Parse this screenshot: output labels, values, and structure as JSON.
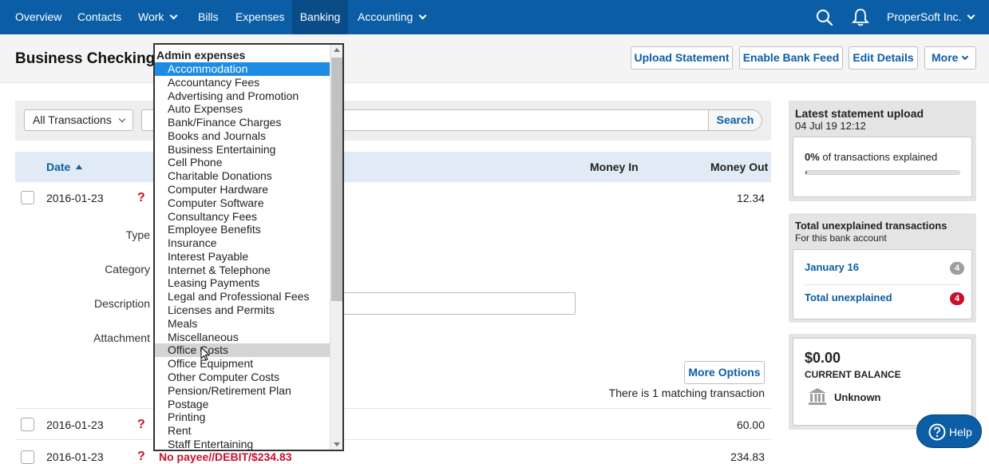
{
  "nav": {
    "items": [
      "Overview",
      "Contacts",
      "Work",
      "Bills",
      "Expenses",
      "Banking",
      "Accounting"
    ],
    "company": "ProperSoft Inc."
  },
  "header": {
    "title": "Business Checking",
    "buttons": [
      "Upload Statement",
      "Enable Bank Feed",
      "Edit Details",
      "More"
    ]
  },
  "filters": {
    "transactions_select": "All Transactions",
    "search_label": "Search"
  },
  "table": {
    "columns": {
      "date": "Date",
      "money_in": "Money In",
      "money_out": "Money Out"
    },
    "rows": [
      {
        "date": "2016-01-23",
        "money_out": "12.34"
      },
      {
        "date": "2016-01-23",
        "money_out": "60.00"
      },
      {
        "date": "2016-01-23",
        "desc": "No payee//DEBIT/$234.83",
        "money_out": "234.83"
      }
    ],
    "expanded": {
      "labels": [
        "Type",
        "Category",
        "Description",
        "Attachment"
      ],
      "more_options": "More Options",
      "matching": "There is 1 matching transaction"
    }
  },
  "dropdown": {
    "group": "Admin expenses",
    "items": [
      "Accommodation",
      "Accountancy Fees",
      "Advertising and Promotion",
      "Auto Expenses",
      "Bank/Finance Charges",
      "Books and Journals",
      "Business Entertaining",
      "Cell Phone",
      "Charitable Donations",
      "Computer Hardware",
      "Computer Software",
      "Consultancy Fees",
      "Employee Benefits",
      "Insurance",
      "Interest Payable",
      "Internet & Telephone",
      "Leasing Payments",
      "Legal and Professional Fees",
      "Licenses and Permits",
      "Meals",
      "Miscellaneous",
      "Office Costs",
      "Office Equipment",
      "Other Computer Costs",
      "Pension/Retirement Plan",
      "Postage",
      "Printing",
      "Rent",
      "Staff Entertaining"
    ],
    "selected": "Accommodation",
    "hovered": "Office Costs"
  },
  "sidebar": {
    "statement": {
      "title": "Latest statement upload",
      "date": "04 Jul 19 12:12",
      "percent": "0%",
      "percent_text": "of transactions explained",
      "progress": 0.01
    },
    "unexplained": {
      "title": "Total unexplained transactions",
      "subtitle": "For this bank account",
      "month_label": "January 16",
      "month_count": "4",
      "total_label": "Total unexplained",
      "total_count": "4"
    },
    "balance": {
      "amount": "$0.00",
      "label": "CURRENT BALANCE",
      "status": "Unknown"
    }
  },
  "help": {
    "label": "Help"
  },
  "colors": {
    "brand": "#0b5ea6",
    "selected": "#1f8ce3",
    "alert": "#c8102e"
  },
  "icons": [
    "search-icon",
    "bell-icon",
    "chevron-down-icon",
    "sort-up-icon",
    "bank-icon",
    "help-icon"
  ]
}
